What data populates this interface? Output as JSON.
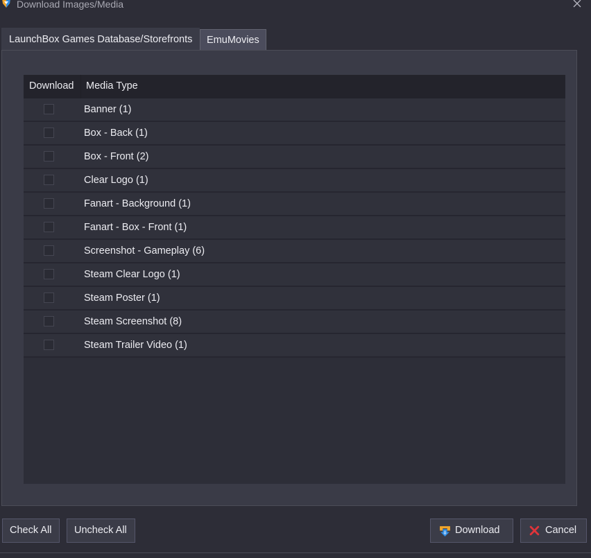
{
  "window": {
    "title": "Download Images/Media"
  },
  "tabs": [
    {
      "label": "LaunchBox Games Database/Storefronts",
      "active": true
    },
    {
      "label": "EmuMovies",
      "active": false
    }
  ],
  "table": {
    "columns": [
      "Download",
      "Media Type"
    ],
    "rows": [
      {
        "checked": false,
        "media_type": "Banner (1)"
      },
      {
        "checked": false,
        "media_type": "Box - Back (1)"
      },
      {
        "checked": false,
        "media_type": "Box - Front (2)"
      },
      {
        "checked": false,
        "media_type": "Clear Logo (1)"
      },
      {
        "checked": false,
        "media_type": "Fanart - Background (1)"
      },
      {
        "checked": false,
        "media_type": "Fanart - Box - Front (1)"
      },
      {
        "checked": false,
        "media_type": "Screenshot - Gameplay (6)"
      },
      {
        "checked": false,
        "media_type": "Steam Clear Logo (1)"
      },
      {
        "checked": false,
        "media_type": "Steam Poster (1)"
      },
      {
        "checked": false,
        "media_type": "Steam Screenshot (8)"
      },
      {
        "checked": false,
        "media_type": "Steam Trailer Video (1)"
      }
    ]
  },
  "buttons": {
    "check_all": "Check All",
    "uncheck_all": "Uncheck All",
    "download": {
      "label": "Download",
      "icon": "download-arrow-icon"
    },
    "cancel": {
      "label": "Cancel",
      "icon": "red-x-icon"
    }
  },
  "colors": {
    "background": "#2d2d37",
    "panel": "#3a3b47",
    "grid_header": "#23232b",
    "accent_blue": "#2f8de4",
    "accent_orange": "#f0a52b",
    "cancel_red": "#e0343a"
  }
}
